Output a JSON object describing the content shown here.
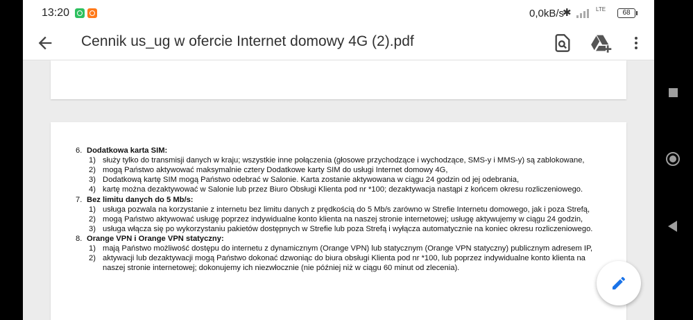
{
  "status_bar": {
    "time": "13:20",
    "network_speed": "0,0kB/s",
    "bluetooth_glyph": "✱",
    "network_type": "LTE",
    "battery_level": "68"
  },
  "app_bar": {
    "title": "Cennik us_ug w ofercie Internet domowy 4G (2).pdf"
  },
  "document": {
    "page1_mark": "‾‾‾",
    "sections": [
      {
        "number": "6.",
        "heading": "Dodatkowa karta SIM:",
        "items": [
          {
            "number": "1)",
            "lines": [
              "służy tylko do transmisji danych w kraju; wszystkie inne połączenia (głosowe przychodzące i wychodzące, SMS-y i MMS-y) są zablokowane,"
            ]
          },
          {
            "number": "2)",
            "lines": [
              "mogą Państwo aktywować maksymalnie cztery Dodatkowe karty SIM do usługi Internet domowy 4G,"
            ]
          },
          {
            "number": "3)",
            "lines": [
              "Dodatkową kartę SIM mogą Państwo odebrać w Salonie. Karta zostanie aktywowana w ciągu 24 godzin od jej odebrania,"
            ]
          },
          {
            "number": "4)",
            "lines": [
              "kartę można dezaktywować w Salonie lub przez Biuro Obsługi Klienta pod nr *100; dezaktywacja nastąpi z końcem okresu rozliczeniowego."
            ]
          }
        ]
      },
      {
        "number": "7.",
        "heading": "Bez limitu danych do 5 Mb/s:",
        "items": [
          {
            "number": "1)",
            "lines": [
              "usługa pozwala na korzystanie z internetu bez limitu danych z prędkością do 5 Mb/s zarówno w Strefie Internetu domowego, jak i poza Strefą,"
            ]
          },
          {
            "number": "2)",
            "lines": [
              "mogą Państwo aktywować usługę poprzez indywidualne konto klienta na naszej stronie internetowej; usługę aktywujemy w ciągu 24 godzin,"
            ]
          },
          {
            "number": "3)",
            "lines": [
              "usługa włącza się po wykorzystaniu pakietów dostępnych w Strefie lub poza Strefą i wyłącza automatycznie na koniec okresu rozliczeniowego."
            ]
          }
        ]
      },
      {
        "number": "8.",
        "heading": "Orange VPN i Orange VPN statyczny:",
        "items": [
          {
            "number": "1)",
            "lines": [
              "mają Państwo możliwość dostępu do internetu z dynamicznym (Orange VPN) lub statycznym (Orange VPN statyczny) publicznym adresem IP,"
            ]
          },
          {
            "number": "2)",
            "lines": [
              "aktywacji lub dezaktywacji mogą Państwo dokonać dzwoniąc do biura obsługi Klienta pod nr *100, lub poprzez indywidualne konto klienta na",
              "naszej stronie internetowej; dokonujemy ich niezwłocznie (nie później niż w ciągu 60 minut od zlecenia)."
            ]
          }
        ]
      }
    ]
  },
  "icons": {
    "back": "arrow-back-icon",
    "search_document": "find-in-page-icon",
    "drive": "add-to-drive-icon",
    "more": "more-vert-icon",
    "edit": "pencil-icon"
  },
  "colors": {
    "fab_icon": "#1a73e8",
    "title_text": "#303030",
    "viewer_background": "#ececec"
  }
}
